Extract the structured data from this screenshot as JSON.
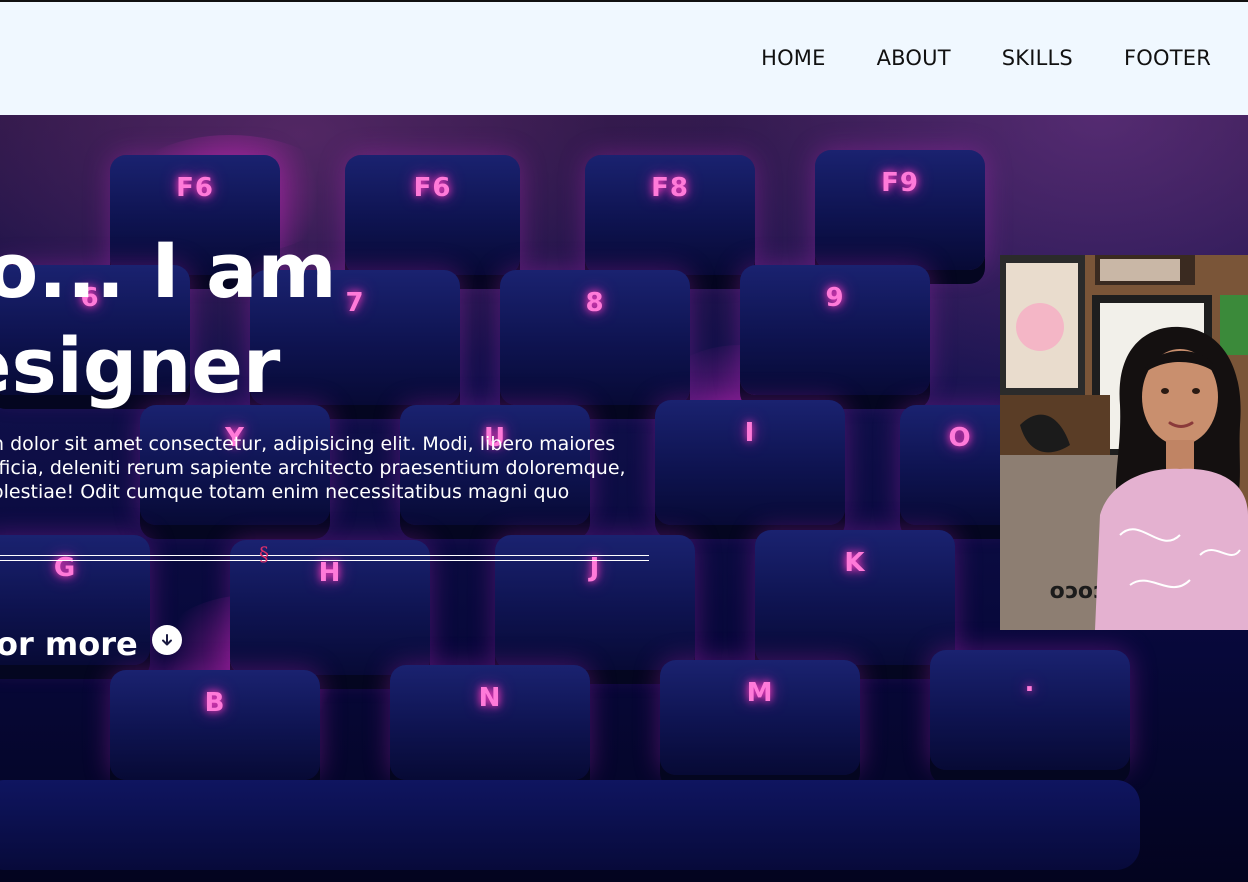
{
  "nav": {
    "items": [
      {
        "label": "HOME"
      },
      {
        "label": "ABOUT"
      },
      {
        "label": "SKILLS"
      },
      {
        "label": "FOOTER"
      }
    ]
  },
  "hero": {
    "title_line1": "lo... I am",
    "title_line2": "esigner",
    "description": "n dolor sit amet consectetur, adipisicing elit. Modi, libero maiores fficia, deleniti rerum sapiente architecto praesentium doloremque, olestiae! Odit cumque totam enim necessitatibus magni quo",
    "divider_mark": "§",
    "scroll_label": "or more",
    "scroll_icon": "arrow-down-icon"
  },
  "background": {
    "key_labels": [
      "F6",
      "F6",
      "F8",
      "F9",
      "6",
      "7",
      "8",
      "9",
      "Y",
      "U",
      "I",
      "O",
      "G",
      "H",
      "J",
      "K",
      "B",
      "N",
      "M",
      "."
    ],
    "glow_color": "#ff3fc0"
  },
  "photo": {
    "sign_text": "coco"
  }
}
